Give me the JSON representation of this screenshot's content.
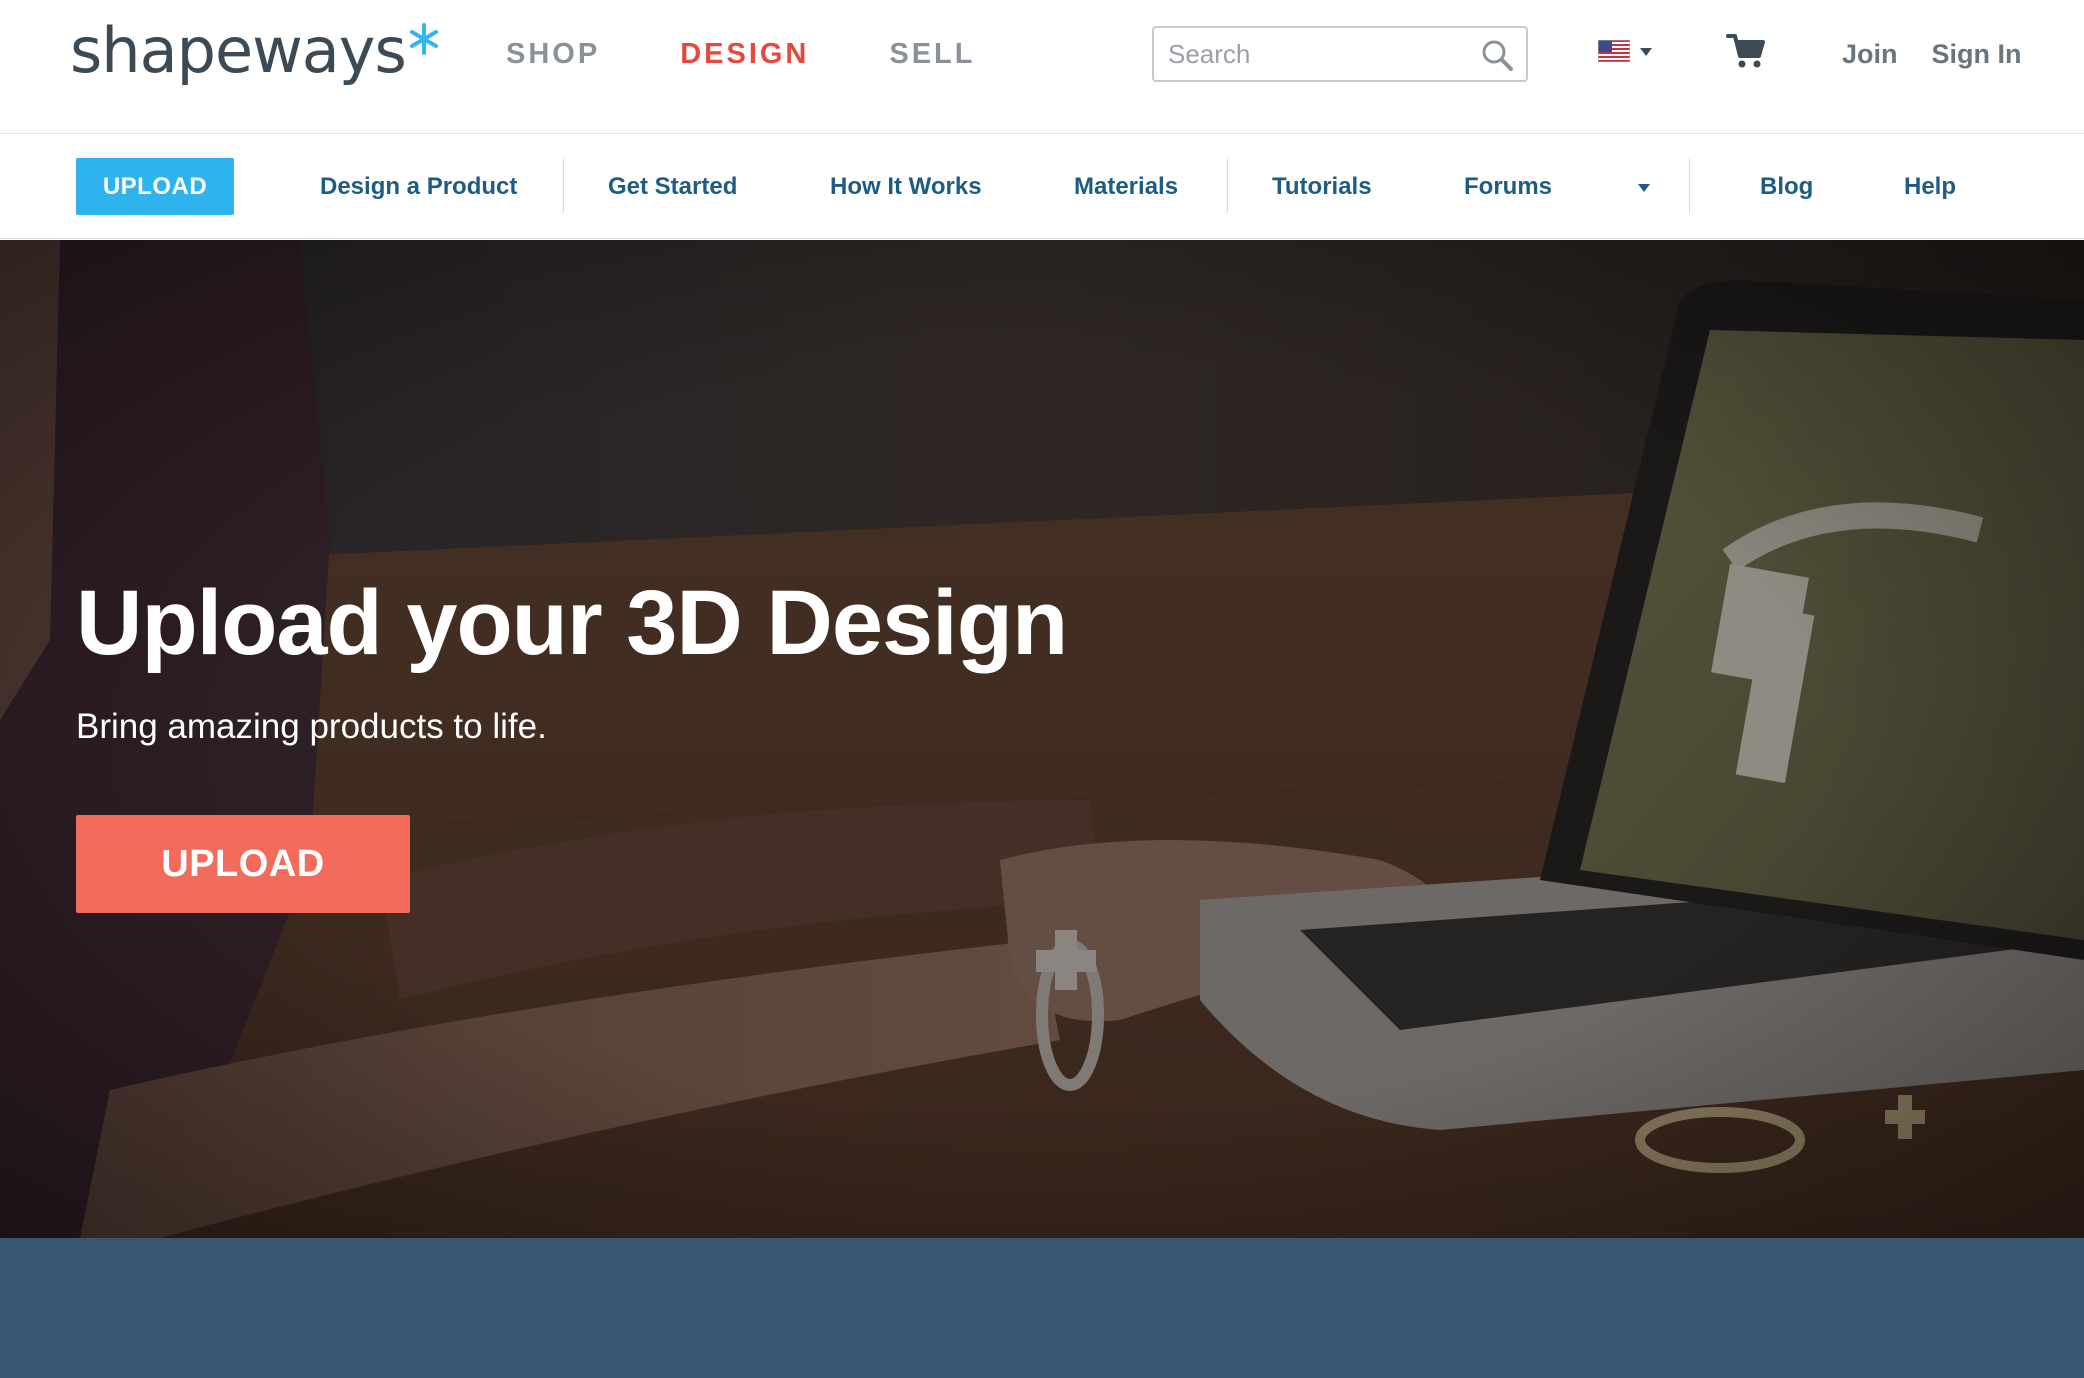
{
  "header": {
    "logo_text": "shapeways",
    "nav": [
      {
        "label": "SHOP",
        "active": false
      },
      {
        "label": "DESIGN",
        "active": true
      },
      {
        "label": "SELL",
        "active": false
      }
    ],
    "search_placeholder": "Search",
    "flag_icon": "us-flag-icon",
    "cart_icon": "shopping-cart-icon",
    "join_label": "Join",
    "signin_label": "Sign In"
  },
  "subnav": {
    "upload_label": "UPLOAD",
    "items": [
      {
        "label": "Design a Product"
      },
      {
        "label": "Get Started"
      },
      {
        "label": "How It Works"
      },
      {
        "label": "Materials"
      },
      {
        "label": "Tutorials"
      },
      {
        "label": "Forums"
      },
      {
        "label": "Blog"
      },
      {
        "label": "Help"
      }
    ]
  },
  "hero": {
    "title": "Upload your 3D Design",
    "subtitle": "Bring amazing products to life.",
    "upload_label": "UPLOAD"
  },
  "colors": {
    "brand_blue": "#2fb3ef",
    "active_nav_red": "#e5493d",
    "cta_coral": "#f26b5b",
    "subnav_link": "#1d5d85",
    "footer_band": "#38566f"
  }
}
